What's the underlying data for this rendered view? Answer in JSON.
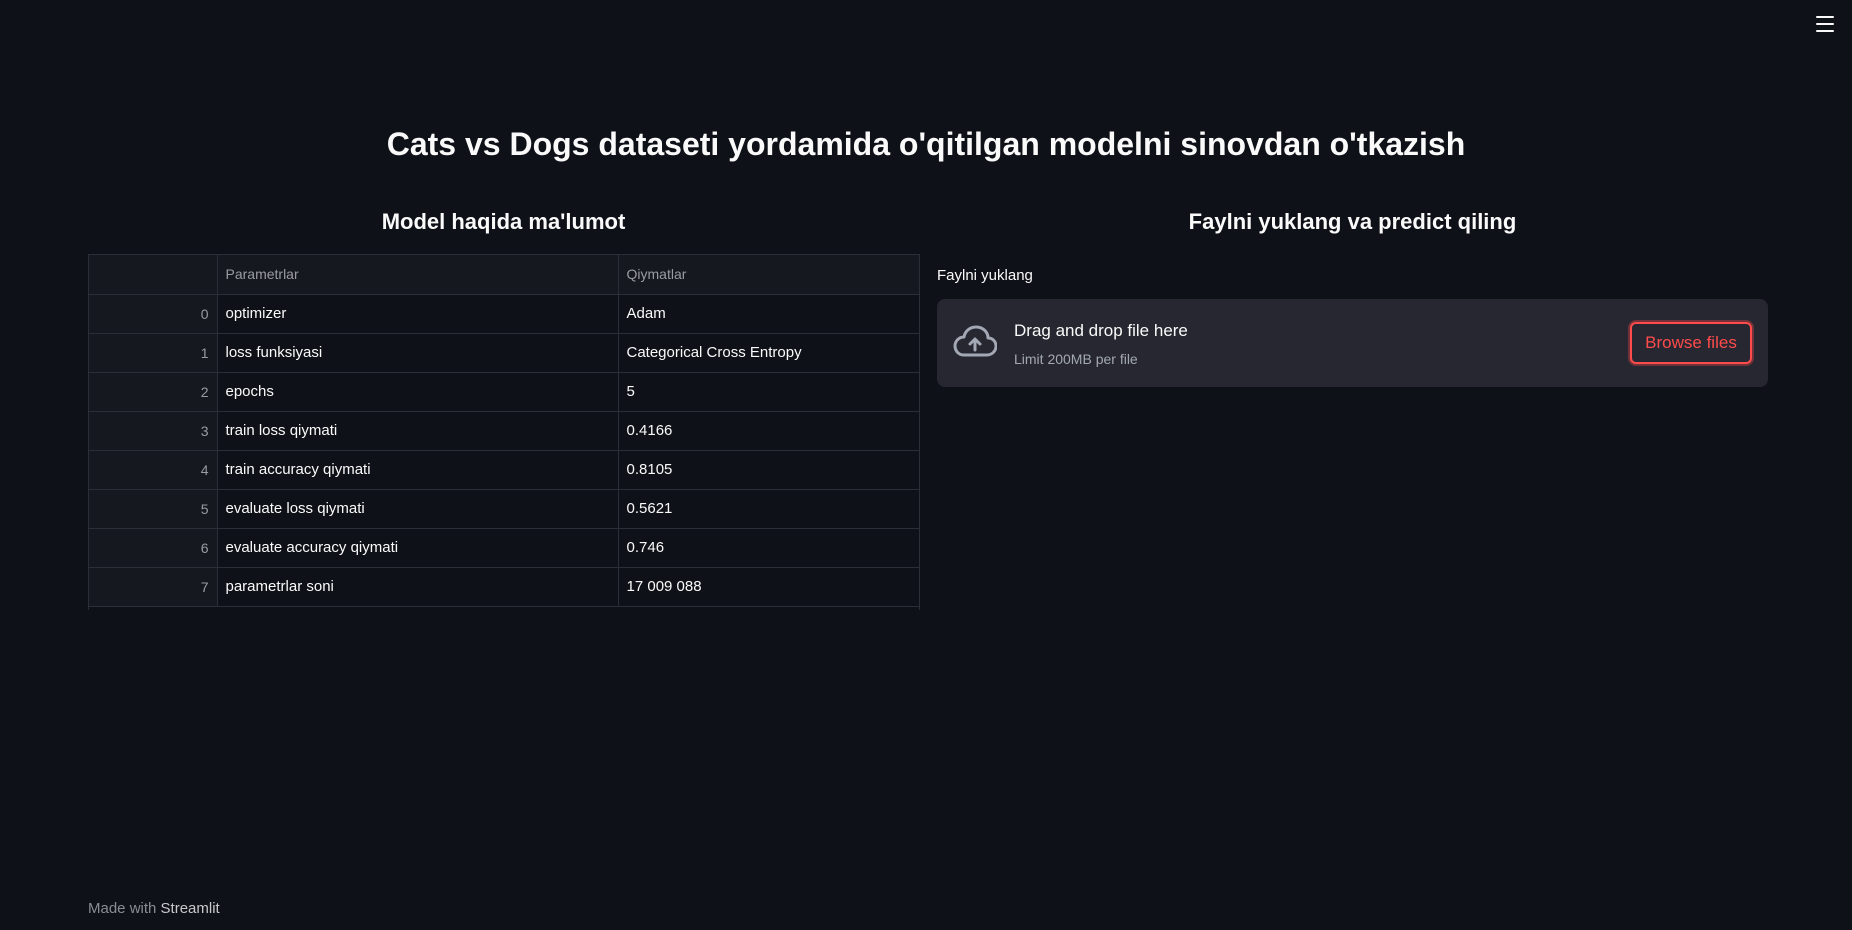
{
  "menu": {
    "icon": "hamburger-menu-icon"
  },
  "title": "Cats vs Dogs dataseti yordamida o'qitilgan modelni sinovdan o'tkazish",
  "left": {
    "heading": "Model haqida ma'lumot",
    "table": {
      "columns": [
        "",
        "Parametrlar",
        "Qiymatlar"
      ],
      "rows": [
        {
          "index": "0",
          "param": "optimizer",
          "value": "Adam"
        },
        {
          "index": "1",
          "param": "loss funksiyasi",
          "value": "Categorical Cross Entropy"
        },
        {
          "index": "2",
          "param": "epochs",
          "value": "5"
        },
        {
          "index": "3",
          "param": "train loss qiymati",
          "value": "0.4166"
        },
        {
          "index": "4",
          "param": "train accuracy qiymati",
          "value": "0.8105"
        },
        {
          "index": "5",
          "param": "evaluate loss qiymati",
          "value": "0.5621"
        },
        {
          "index": "6",
          "param": "evaluate accuracy qiymati",
          "value": "0.746"
        },
        {
          "index": "7",
          "param": "parametrlar soni",
          "value": "17 009 088"
        }
      ]
    }
  },
  "right": {
    "heading": "Faylni yuklang va predict qiling",
    "upload_label": "Faylni yuklang",
    "dropzone": {
      "title": "Drag and drop file here",
      "limit": "Limit 200MB per file",
      "icon": "cloud-upload-icon"
    },
    "browse_label": "Browse files"
  },
  "footer": {
    "prefix": "Made with",
    "brand": "Streamlit"
  },
  "colors": {
    "background": "#0e1117",
    "accent": "#ff4b4b",
    "dropzone": "#262730"
  }
}
